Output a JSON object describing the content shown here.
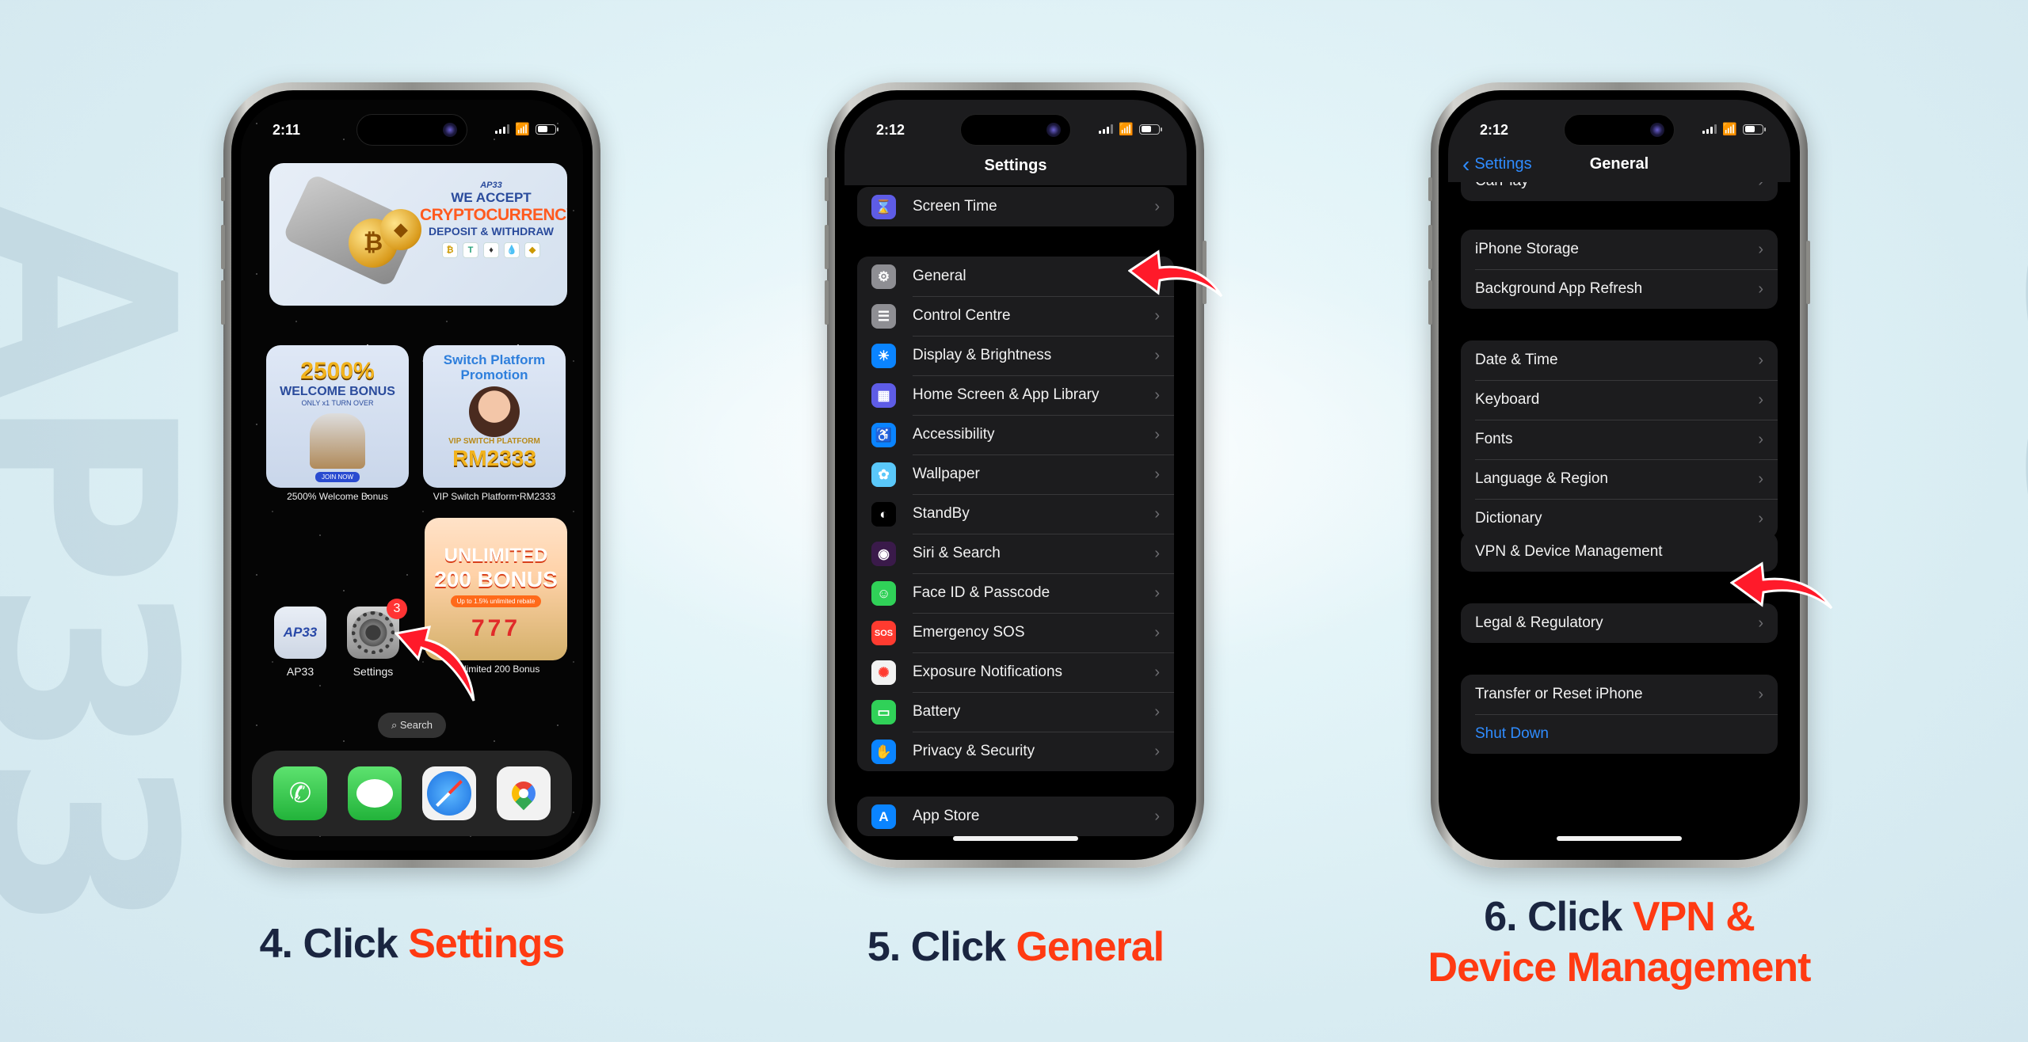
{
  "watermark": "AP33",
  "steps": [
    {
      "number": "4.",
      "verb": "Click",
      "target": "Settings",
      "phone": {
        "time": "2:11",
        "screen": "home",
        "widgets": [
          {
            "id": "crypto",
            "brand": "AP33",
            "line1": "WE ACCEPT",
            "line2": "CRYPTOCURRENCY",
            "line3": "DEPOSIT & WITHDRAW",
            "coins": [
              "₿",
              "T",
              "♦",
              "💧",
              "◆"
            ]
          },
          {
            "id": "welcome",
            "headline": "2500%",
            "title": "WELCOME BONUS",
            "sub": "ONLY x1 TURN OVER",
            "cta": "JOIN NOW",
            "label": "2500% Welcome Bonus"
          },
          {
            "id": "vip",
            "headline1": "Switch Platform",
            "headline2": "Promotion",
            "title": "VIP SWITCH PLATFORM",
            "amount": "RM2333",
            "label": "VIP Switch Platform RM2333"
          },
          {
            "id": "unlimited",
            "headline1": "UNLIMITED",
            "headline2": "200 BONUS",
            "pill": "Up to 1.5% unlimited rebate",
            "slots": "777",
            "label": "Unlimited 200 Bonus"
          }
        ],
        "apps": [
          {
            "name": "AP33",
            "logo": "AP33"
          },
          {
            "name": "Settings",
            "badge": "3"
          }
        ],
        "search_label": "Search",
        "dock": [
          "Phone",
          "Messages",
          "Safari",
          "Google Maps"
        ]
      }
    },
    {
      "number": "5.",
      "verb": "Click",
      "target": "General",
      "phone": {
        "time": "2:12",
        "screen": "settings",
        "title": "Settings",
        "groups": [
          [
            {
              "label": "Screen Time",
              "icon": "hourglass-icon",
              "color": "#5e5ce6",
              "glyph": "⌛"
            }
          ],
          [
            {
              "label": "General",
              "icon": "gear-icon",
              "color": "#8e8e93",
              "glyph": "⚙"
            },
            {
              "label": "Control Centre",
              "icon": "toggles-icon",
              "color": "#8e8e93",
              "glyph": "☰"
            },
            {
              "label": "Display & Brightness",
              "icon": "sun-icon",
              "color": "#0a84ff",
              "glyph": "☀"
            },
            {
              "label": "Home Screen & App Library",
              "icon": "grid-icon",
              "color": "#5e5ce6",
              "glyph": "▦"
            },
            {
              "label": "Accessibility",
              "icon": "accessibility-icon",
              "color": "#0a84ff",
              "glyph": "♿"
            },
            {
              "label": "Wallpaper",
              "icon": "flower-icon",
              "color": "#5ac8fa",
              "glyph": "✿"
            },
            {
              "label": "StandBy",
              "icon": "standby-icon",
              "color": "#000000",
              "glyph": "◐"
            },
            {
              "label": "Siri & Search",
              "icon": "siri-icon",
              "color": "#3a1a4a",
              "glyph": "◉"
            },
            {
              "label": "Face ID & Passcode",
              "icon": "face-id-icon",
              "color": "#30d158",
              "glyph": "☺"
            },
            {
              "label": "Emergency SOS",
              "icon": "sos-icon",
              "color": "#ff3b30",
              "glyph": "SOS"
            },
            {
              "label": "Exposure Notifications",
              "icon": "exposure-icon",
              "color": "#f2f2f2",
              "glyph": "✺"
            },
            {
              "label": "Battery",
              "icon": "battery-icon",
              "color": "#30d158",
              "glyph": "▭"
            },
            {
              "label": "Privacy & Security",
              "icon": "hand-icon",
              "color": "#0a84ff",
              "glyph": "✋"
            }
          ],
          [
            {
              "label": "App Store",
              "icon": "app-store-icon",
              "color": "#0a84ff",
              "glyph": "A"
            }
          ]
        ]
      }
    },
    {
      "number": "6.",
      "verb": "Click",
      "target": "VPN & Device Management",
      "target_line1": "VPN &",
      "target_line2": "Device Management",
      "phone": {
        "time": "2:12",
        "screen": "general",
        "back_label": "Settings",
        "title": "General",
        "partial_row": "CarPlay",
        "groups": [
          [
            "iPhone Storage",
            "Background App Refresh"
          ],
          [
            "Date & Time",
            "Keyboard",
            "Fonts",
            "Language & Region",
            "Dictionary"
          ],
          [
            "VPN & Device Management"
          ],
          [
            "Legal & Regulatory"
          ],
          [
            "Transfer or Reset iPhone"
          ]
        ],
        "shutdown_label": "Shut Down"
      }
    }
  ],
  "colors": {
    "accent_red": "#ff3a12",
    "caption_dark": "#1a2540",
    "ios_blue": "#2f8cff",
    "arrow_red": "#ff1a2a"
  }
}
